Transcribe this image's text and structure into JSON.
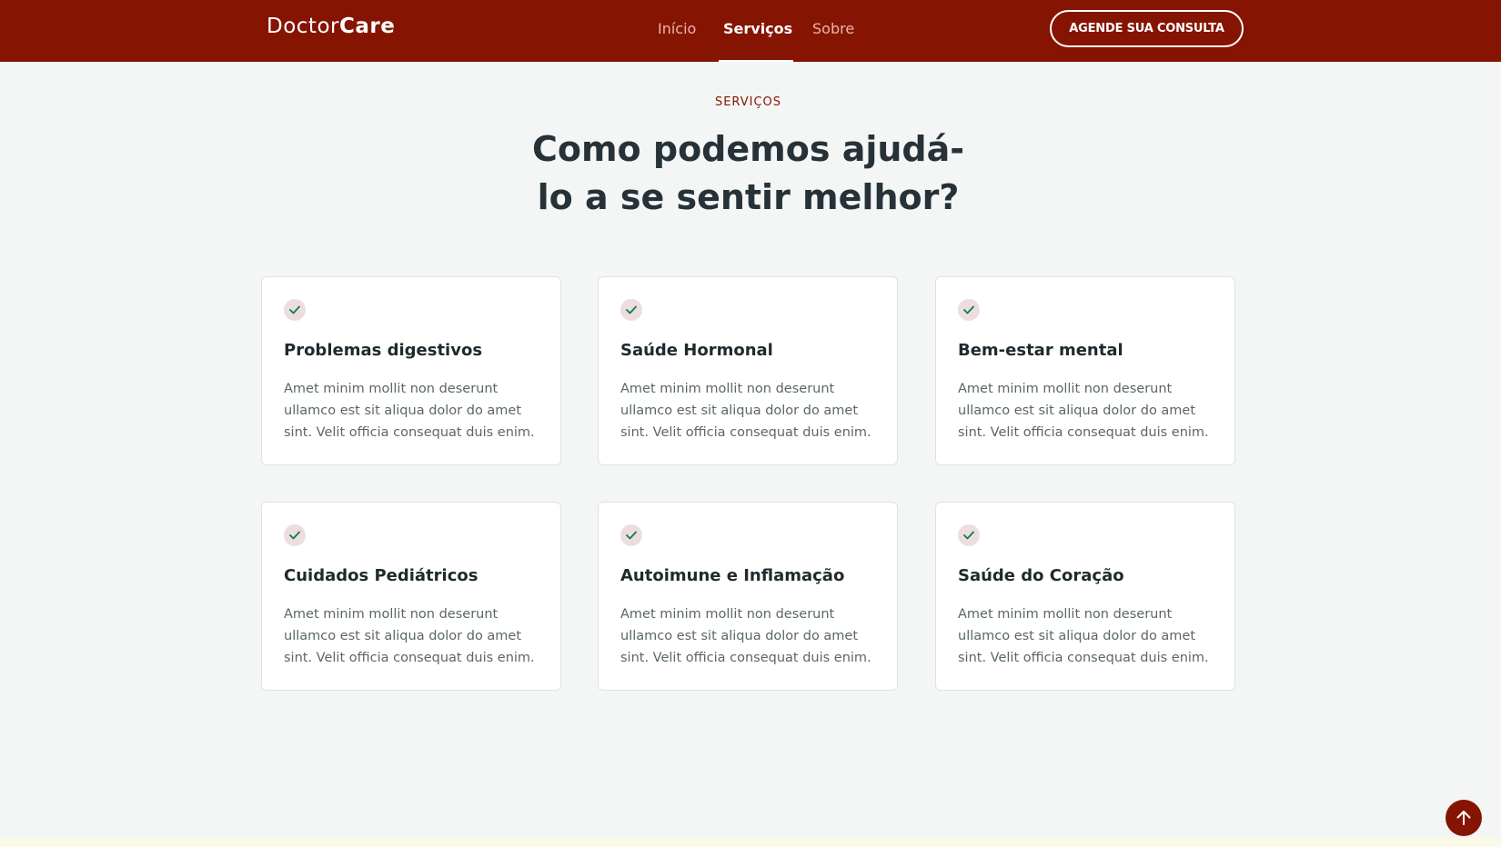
{
  "header": {
    "logo_regular": "Doctor",
    "logo_bold": "Care",
    "nav": [
      {
        "label": "Início"
      },
      {
        "label": "Serviços"
      },
      {
        "label": "Sobre"
      }
    ],
    "active_nav": "Serviços",
    "cta_label": "AGENDE SUA CONSULTA"
  },
  "services": {
    "eyebrow": "SERVIÇOS",
    "headline_line1": "Como podemos ajudá-",
    "headline_line2": "lo a se sentir melhor?",
    "cards": [
      {
        "icon": "check-icon",
        "title": "Problemas digestivos",
        "text": "Amet minim mollit non deserunt ullamco est sit aliqua dolor do amet sint. Velit officia consequat duis enim."
      },
      {
        "icon": "check-icon",
        "title": "Saúde Hormonal",
        "text": "Amet minim mollit non deserunt ullamco est sit aliqua dolor do amet sint. Velit officia consequat duis enim."
      },
      {
        "icon": "check-icon",
        "title": "Bem-estar mental",
        "text": "Amet minim mollit non deserunt ullamco est sit aliqua dolor do amet sint. Velit officia consequat duis enim."
      },
      {
        "icon": "check-icon",
        "title": "Cuidados Pediátricos",
        "text": "Amet minim mollit non deserunt ullamco est sit aliqua dolor do amet sint. Velit officia consequat duis enim."
      },
      {
        "icon": "check-icon",
        "title": "Autoimune e Inflamação",
        "text": "Amet minim mollit non deserunt ullamco est sit aliqua dolor do amet sint. Velit officia consequat duis enim."
      },
      {
        "icon": "check-icon",
        "title": "Saúde do Coração",
        "text": "Amet minim mollit non deserunt ullamco est sit aliqua dolor do amet sint. Velit officia consequat duis enim."
      }
    ]
  },
  "back_to_top_icon": "arrow-up-icon",
  "colors": {
    "brand": "#861402",
    "background": "#f4f6f5",
    "check_bg": "#ecdede",
    "check_mark": "#0f7a5c"
  }
}
